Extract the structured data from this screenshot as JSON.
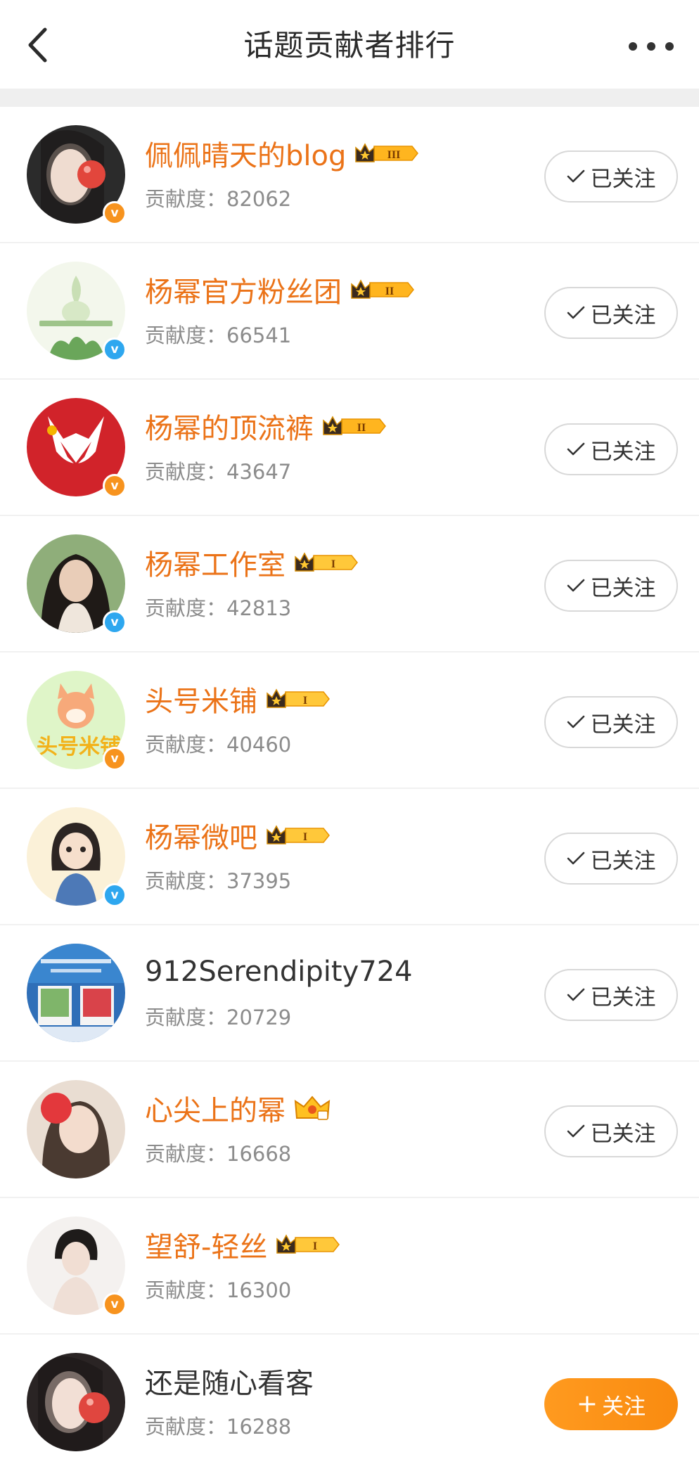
{
  "header": {
    "title": "话题贡献者排行"
  },
  "contributors": [
    {
      "name": "佩佩晴天的blog",
      "score": "贡献度：82062",
      "level": "III",
      "verified": "orange",
      "follow": "已关注",
      "followed": true
    },
    {
      "name": "杨幂官方粉丝团",
      "score": "贡献度：66541",
      "level": "II",
      "verified": "blue",
      "follow": "已关注",
      "followed": true
    },
    {
      "name": "杨幂的顶流裤",
      "score": "贡献度：43647",
      "level": "II",
      "verified": "orange",
      "follow": "已关注",
      "followed": true
    },
    {
      "name": "杨幂工作室",
      "score": "贡献度：42813",
      "level": "I",
      "verified": "blue",
      "follow": "已关注",
      "followed": true
    },
    {
      "name": "头号米铺",
      "score": "贡献度：40460",
      "level": "I",
      "verified": "orange",
      "follow": "已关注",
      "followed": true
    },
    {
      "name": "杨幂微吧",
      "score": "贡献度：37395",
      "level": "I",
      "verified": "blue",
      "follow": "已关注",
      "followed": true
    },
    {
      "name": "912Serendipity724",
      "score": "贡献度：20729",
      "level": "",
      "verified": "",
      "follow": "已关注",
      "followed": true
    },
    {
      "name": "心尖上的幂",
      "score": "贡献度：16668",
      "level": "crown",
      "verified": "",
      "follow": "已关注",
      "followed": true
    },
    {
      "name": "望舒-轻丝",
      "score": "贡献度：16300",
      "level": "I",
      "verified": "orange",
      "follow": "",
      "followed": false
    },
    {
      "name": "还是随心看客",
      "score": "贡献度：16288",
      "level": "",
      "verified": "",
      "follow": "关注",
      "followed": false
    }
  ],
  "colors": {
    "accent_orange": "#eb7318",
    "follow_orange": "#f98b10",
    "verified_blue": "#2ea7ef",
    "verified_orange": "#f7931e"
  }
}
